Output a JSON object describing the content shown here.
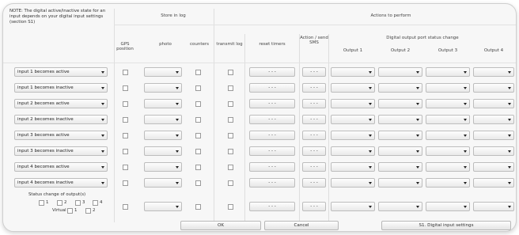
{
  "note": "NOTE: The digital active/inactive state for an input depends on your digital input settings (section S1)",
  "headers": {
    "store_in_log": "Store in log",
    "actions": "Actions to perform",
    "gps": "GPS position",
    "photo": "photo",
    "counters": "counters",
    "transmit": "transmit log",
    "reset_timers": "reset timers",
    "action_sms": "Action / send SMS",
    "output_group": "Digital output port status change",
    "output1": "Output 1",
    "output2": "Output 2",
    "output3": "Output 3",
    "output4": "Output 4"
  },
  "rows": [
    {
      "event": "input 1 becomes active",
      "reset": "- - -",
      "sms": "- - -"
    },
    {
      "event": "input 1 becomes inactive",
      "reset": "- - -",
      "sms": "- - -"
    },
    {
      "event": "input 2 becomes active",
      "reset": "- - -",
      "sms": "- - -"
    },
    {
      "event": "input 2 becomes inactive",
      "reset": "- - -",
      "sms": "- - -"
    },
    {
      "event": "input 3 becomes active",
      "reset": "- - -",
      "sms": "- - -"
    },
    {
      "event": "input 3 becomes inactive",
      "reset": "- - -",
      "sms": "- - -"
    },
    {
      "event": "input 4 becomes active",
      "reset": "- - -",
      "sms": "- - -"
    },
    {
      "event": "input 4 becomes inactive",
      "reset": "- - -",
      "sms": "- - -"
    }
  ],
  "status_block": {
    "title": "Status change of output(s)",
    "outputs": [
      "1",
      "2",
      "3",
      "4"
    ],
    "virtual_label": "Virtual",
    "virtual": [
      "1",
      "2"
    ],
    "reset": "- - -",
    "sms": "- - -"
  },
  "buttons": {
    "ok": "OK",
    "cancel": "Cancel",
    "settings": "S1. Digital input settings"
  }
}
